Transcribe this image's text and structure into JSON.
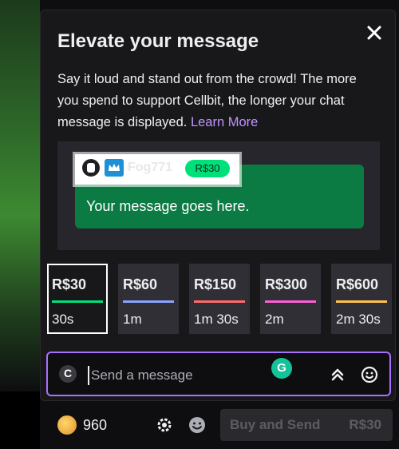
{
  "modal": {
    "title": "Elevate your message",
    "description": "Say it loud and stand out from the crowd! The more you spend to support Cellbit, the longer your chat message is displayed.",
    "learn_more": "Learn More"
  },
  "preview": {
    "username": "Fog771",
    "amount": "R$30",
    "message": "Your message goes here."
  },
  "tiers": [
    {
      "amount": "R$30",
      "duration": "30s",
      "color": "#00e07a",
      "selected": true
    },
    {
      "amount": "R$60",
      "duration": "1m",
      "color": "#8ba4ff"
    },
    {
      "amount": "R$150",
      "duration": "1m 30s",
      "color": "#ff6b6b"
    },
    {
      "amount": "R$300",
      "duration": "2m",
      "color": "#ff5ed6"
    },
    {
      "amount": "R$600",
      "duration": "2m 30s",
      "color": "#ffc14d"
    }
  ],
  "chat_input": {
    "placeholder": "Send a message",
    "grammarly_icon": "G"
  },
  "footer": {
    "points": "960",
    "buy_label": "Buy and Send",
    "buy_price": "R$30"
  },
  "colors": {
    "accent": "#a970ff",
    "preview_green": "#0b7a43",
    "learn_link": "#bf94ff"
  }
}
